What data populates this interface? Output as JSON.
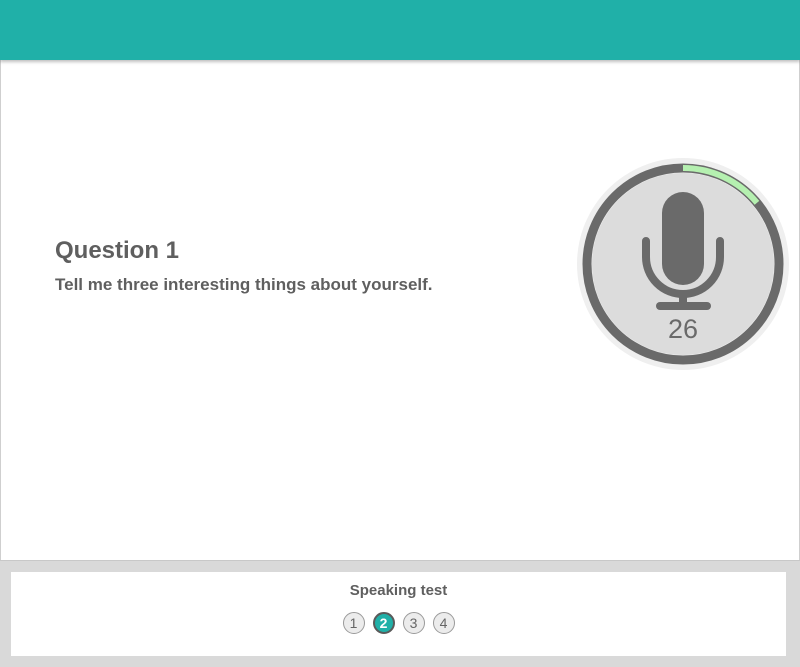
{
  "colors": {
    "header": "#20b0a8",
    "accent": "#20b0a8",
    "progress_arc": "#b5f0b0",
    "mic": "#6a6a6a",
    "mic_bg": "#dcdcdc"
  },
  "question": {
    "title": "Question 1",
    "text": "Tell me three interesting things about yourself."
  },
  "recorder": {
    "icon": "microphone-icon",
    "countdown": "26",
    "progress_fraction": 0.14
  },
  "footer": {
    "title": "Speaking test",
    "steps": [
      {
        "label": "1",
        "active": false
      },
      {
        "label": "2",
        "active": true
      },
      {
        "label": "3",
        "active": false
      },
      {
        "label": "4",
        "active": false
      }
    ]
  }
}
